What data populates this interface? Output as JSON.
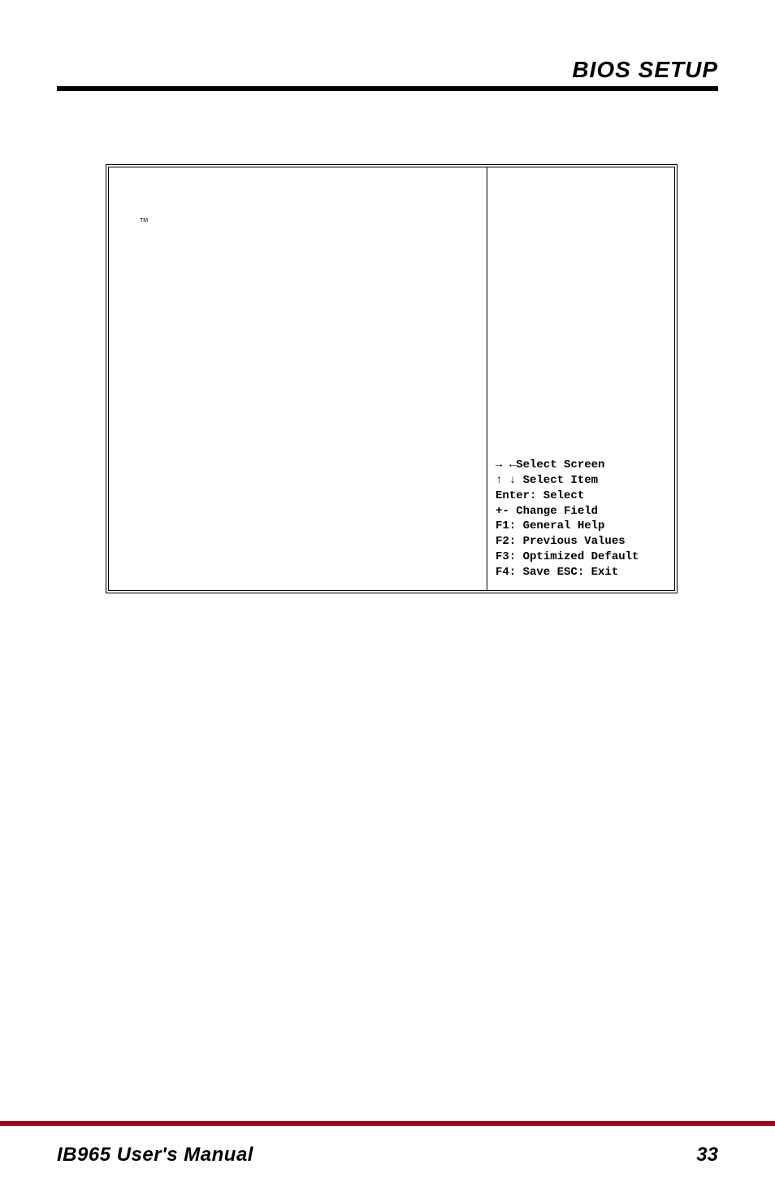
{
  "header": {
    "title": "BIOS SETUP"
  },
  "bios": {
    "tm_text": "TM"
  },
  "nav": {
    "select_screen": "→ ←Select Screen",
    "select_item": "↑ ↓ Select Item",
    "enter": "Enter: Select",
    "change_field": "+-  Change Field",
    "general_help": "F1: General Help",
    "previous": "F2: Previous Values",
    "optimized": "F3: Optimized Default",
    "save_exit": "F4: Save  ESC: Exit"
  },
  "footer": {
    "manual_title": "IB965 User's Manual",
    "page_number": "33"
  }
}
